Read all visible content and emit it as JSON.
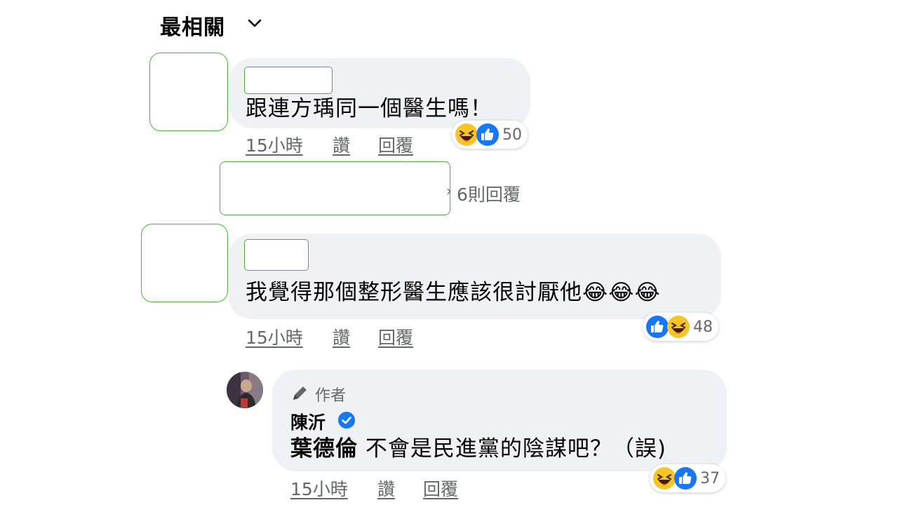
{
  "header": {
    "sort_label": "最相關"
  },
  "comments": [
    {
      "text": "跟連方瑀同一個醫生嗎！",
      "time": "15小時",
      "like": "讚",
      "reply": "回覆",
      "reaction_count": "50",
      "reactions": [
        "haha-icon",
        "like-icon"
      ]
    },
    {
      "text": "我覺得那個整形醫生應該很討厭他",
      "emoji": "😂😂😂",
      "time": "15小時",
      "like": "讚",
      "reply": "回覆",
      "reaction_count": "48",
      "reactions": [
        "like-icon",
        "haha-icon"
      ]
    }
  ],
  "replies_link": "6則回覆",
  "author_reply": {
    "badge": "作者",
    "name": "陳沂",
    "mention": "葉德倫",
    "text": " 不會是民進黨的陰謀吧？（誤)",
    "time": "15小時",
    "like": "讚",
    "reply": "回覆",
    "reaction_count": "37",
    "reactions": [
      "haha-icon",
      "like-icon"
    ]
  },
  "colors": {
    "bubble": "#eff1f4",
    "meta_text": "#65676b",
    "like_blue": "#1877f2",
    "haha_yellow": "#f7c42a",
    "placeholder_border": "#4caf3c"
  }
}
